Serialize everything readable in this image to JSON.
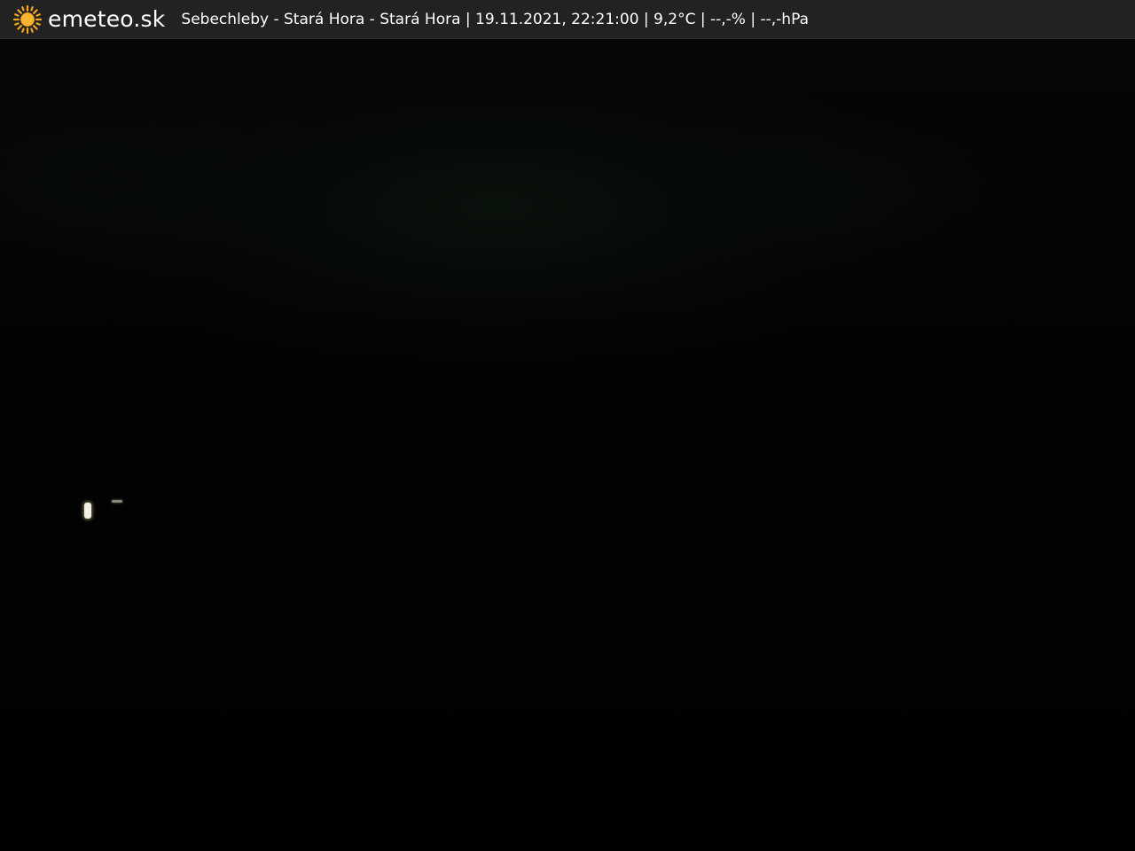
{
  "header": {
    "brand": "emeteo.sk",
    "logo_icon": "sun-icon",
    "caption": "Sebechleby - Stará Hora - Stará Hora | 19.11.2021, 22:21:00 | 9,2°C | --,-% | --,-hPa"
  },
  "colors": {
    "header_bg": "#222222",
    "sun": "#f5a623",
    "text": "#ffffff"
  }
}
